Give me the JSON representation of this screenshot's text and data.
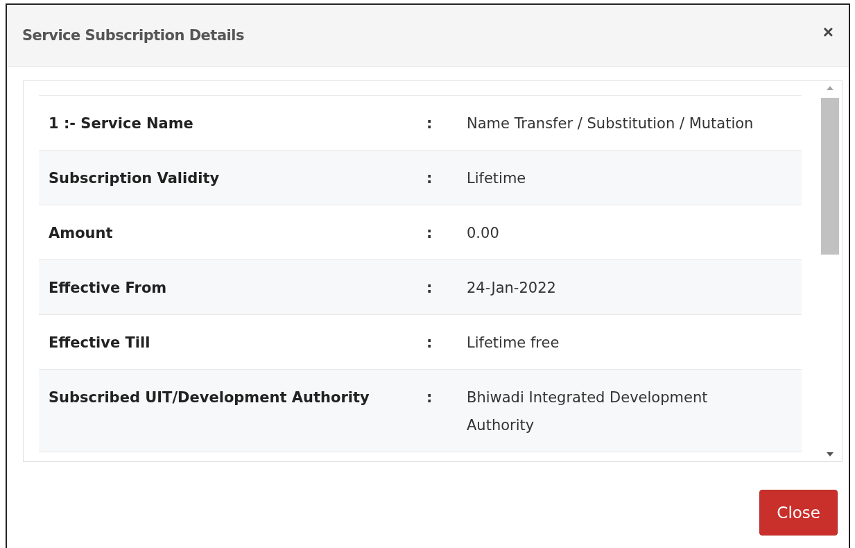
{
  "dialog": {
    "title": "Service Subscription Details",
    "close_icon": "×",
    "rows": [
      {
        "label": "1 :- Service Name",
        "separator": ":",
        "value": "Name Transfer / Substitution / Mutation"
      },
      {
        "label": "Subscription Validity",
        "separator": ":",
        "value": "Lifetime"
      },
      {
        "label": "Amount",
        "separator": ":",
        "value": "0.00"
      },
      {
        "label": "Effective From",
        "separator": ":",
        "value": "24-Jan-2022"
      },
      {
        "label": "Effective Till",
        "separator": ":",
        "value": "Lifetime free"
      },
      {
        "label": "Subscribed UIT/Development Authority",
        "separator": ":",
        "value": "Bhiwadi Integrated Development Authority"
      }
    ],
    "buttons": [
      "Close"
    ]
  }
}
